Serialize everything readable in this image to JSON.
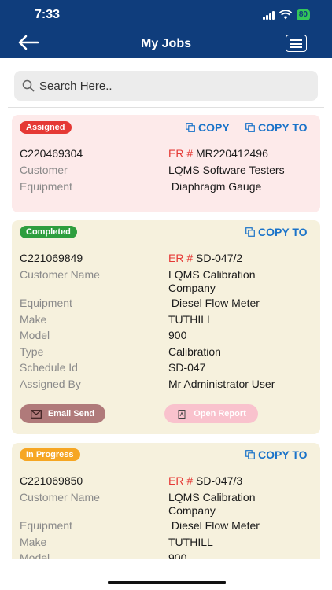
{
  "status_bar": {
    "time": "7:33",
    "battery": "80"
  },
  "header": {
    "title": "My Jobs"
  },
  "search": {
    "placeholder": "Search Here.."
  },
  "cards": [
    {
      "status": "Assigned",
      "status_color": "#e53935",
      "copy_label": "COPY",
      "copy_to_label": "COPY TO",
      "job_id": "C220469304",
      "er_label": "ER #",
      "er_value": "MR220412496",
      "rows": [
        {
          "label": "Customer",
          "value": "LQMS Software Testers"
        },
        {
          "label": "Equipment",
          "value": " Diaphragm Gauge"
        }
      ]
    },
    {
      "status": "Completed",
      "status_color": "#2e9e3e",
      "copy_to_label": "COPY TO",
      "job_id": "C221069849",
      "er_label": "ER #",
      "er_value": "SD-047/2",
      "rows": [
        {
          "label": "Customer Name",
          "value": "LQMS Calibration Company"
        },
        {
          "label": "Equipment",
          "value": " Diesel Flow Meter"
        },
        {
          "label": "Make",
          "value": "TUTHILL"
        },
        {
          "label": "Model",
          "value": "900"
        },
        {
          "label": "Type",
          "value": "Calibration"
        },
        {
          "label": "Schedule Id",
          "value": "SD-047"
        },
        {
          "label": "Assigned By",
          "value": "Mr Administrator User"
        }
      ],
      "email_label": "Email Send",
      "report_label": "Open Report"
    },
    {
      "status": "In Progress",
      "status_color": "#f6a623",
      "copy_to_label": "COPY TO",
      "job_id": "C221069850",
      "er_label": "ER #",
      "er_value": "SD-047/3",
      "rows": [
        {
          "label": "Customer Name",
          "value": "LQMS Calibration Company"
        },
        {
          "label": "Equipment",
          "value": " Diesel Flow Meter"
        },
        {
          "label": "Make",
          "value": "TUTHILL"
        },
        {
          "label": "Model",
          "value": "900"
        }
      ]
    }
  ],
  "colors": {
    "header_bg": "#0f3d7c",
    "link": "#1a73c9",
    "er_red": "#e53935"
  },
  "icons": [
    "back-arrow-icon",
    "menu-icon",
    "search-icon",
    "copy-icon",
    "mail-icon",
    "pdf-icon"
  ]
}
